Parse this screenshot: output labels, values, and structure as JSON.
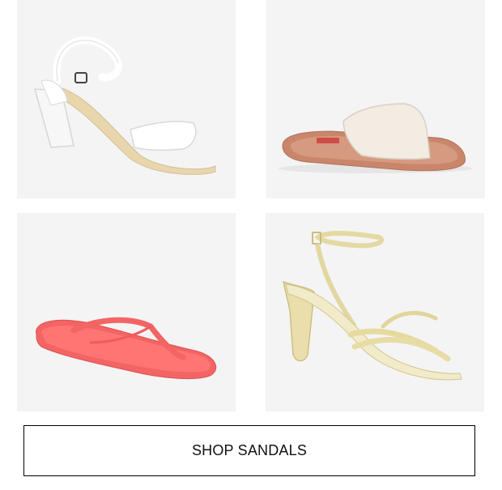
{
  "products": [
    {
      "name": "white-block-heel-sandal",
      "image_color": "#ffffff"
    },
    {
      "name": "cream-slide-sandal",
      "image_color": "#efe9df"
    },
    {
      "name": "coral-flip-flop",
      "image_color": "#f56a6a"
    },
    {
      "name": "gold-strappy-heel",
      "image_color": "#e8dfad"
    }
  ],
  "cta": {
    "label": "SHOP SANDALS"
  }
}
